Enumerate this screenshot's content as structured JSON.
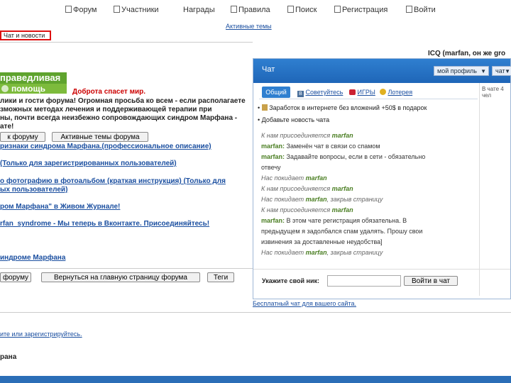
{
  "nav": {
    "items": [
      {
        "label": "Форум"
      },
      {
        "label": "Участники"
      },
      {
        "label": "Награды"
      },
      {
        "label": "Правила"
      },
      {
        "label": "Поиск"
      },
      {
        "label": "Регистрация"
      },
      {
        "label": "Войти"
      }
    ],
    "active_topics": "Активные темы"
  },
  "section_tab": "Чат и новости",
  "banner": {
    "line1": "праведливая",
    "line2": "помощь",
    "slogan": "Доброта спасет мир."
  },
  "welcome": [
    "лики и гости форума! Огромная просьба ко всем - если располагаете",
    "зможных методах лечения и поддерживающей терапии при",
    "ны, почти всегда неизбежно сопровождающих синдром Марфана -",
    "ате!"
  ],
  "mid_buttons": {
    "to_forum": "к форуму",
    "active_topics": "Активные темы форума"
  },
  "links": [
    "ризнаки синдрома Марфана.(профессиональное описание)",
    "(Только для зарегистрированных пользователей)",
    "о фотографию в фотоальбом (краткая инструкция) (Только для",
    "ых пользователей)",
    "ром Марфана\" в Живом Журнале!",
    "rfan_syndrome - Мы теперь в Вконтакте. Присоединяйтесь!",
    "индроме Марфана"
  ],
  "bottom_buttons": {
    "forum": "форуму",
    "home": "Вернуться на главную страницу форума",
    "topics": "Теги"
  },
  "login_text": "ите или зарегистрируйтесь.",
  "footer_name": "рана",
  "chat": {
    "icq": "ICQ (marfan, он же gro",
    "title": "Чат",
    "profile_select": "мой профиль",
    "chat_select": "чат",
    "tabs": {
      "general": "Общий",
      "vk": "Советуйтесь",
      "games": "ИГРЫ",
      "lottery": "Лотерея"
    },
    "side_note": "В чате 4 чел",
    "pinned": "Заработок в интернете без вложений +50$ в подарок",
    "add_news": "Добавьте новость чата",
    "messages": [
      {
        "kind": "sys",
        "text": "К нам присоединяется",
        "nick": "marfan",
        "tail": ""
      },
      {
        "kind": "msg",
        "nick": "marfan:",
        "text": "Заменён чат в связи со спамом"
      },
      {
        "kind": "msg",
        "nick": "marfan:",
        "text": "Задавайте вопросы, если в сети - обязательно"
      },
      {
        "kind": "cont",
        "text": "отвечу"
      },
      {
        "kind": "sys",
        "text": "Нас покидает",
        "nick": "marfan",
        "tail": ""
      },
      {
        "kind": "sys",
        "text": "К нам присоединяется",
        "nick": "marfan",
        "tail": ""
      },
      {
        "kind": "sys",
        "text": "Нас покидает",
        "nick": "marfan",
        "tail": ", закрыв страницу"
      },
      {
        "kind": "sys",
        "text": "К нам присоединяется",
        "nick": "marfan",
        "tail": ""
      },
      {
        "kind": "msg",
        "nick": "marfan:",
        "text": "В этом чате регистрация обязательна. В"
      },
      {
        "kind": "cont",
        "text": "предыдущем я задолбался спам удалять. Прошу свои"
      },
      {
        "kind": "cont",
        "text": "извинения за доставленные неудобства]"
      },
      {
        "kind": "sys",
        "text": "Нас покидает",
        "nick": "marfan",
        "tail": ", закрыв страницу"
      }
    ],
    "nick_label": "Укажите свой ник:",
    "nick_placeholder": "",
    "enter_button": "Войти в чат",
    "free_chat_link": "Бесплатный чат для вашего сайта."
  },
  "colors": {
    "chat_header": "#2f7fd0",
    "bottom_bar": "#2b6eb7",
    "banner_green": "#5fa32e",
    "nick_green": "#4a7e22",
    "slogan_red": "#cc0000"
  }
}
